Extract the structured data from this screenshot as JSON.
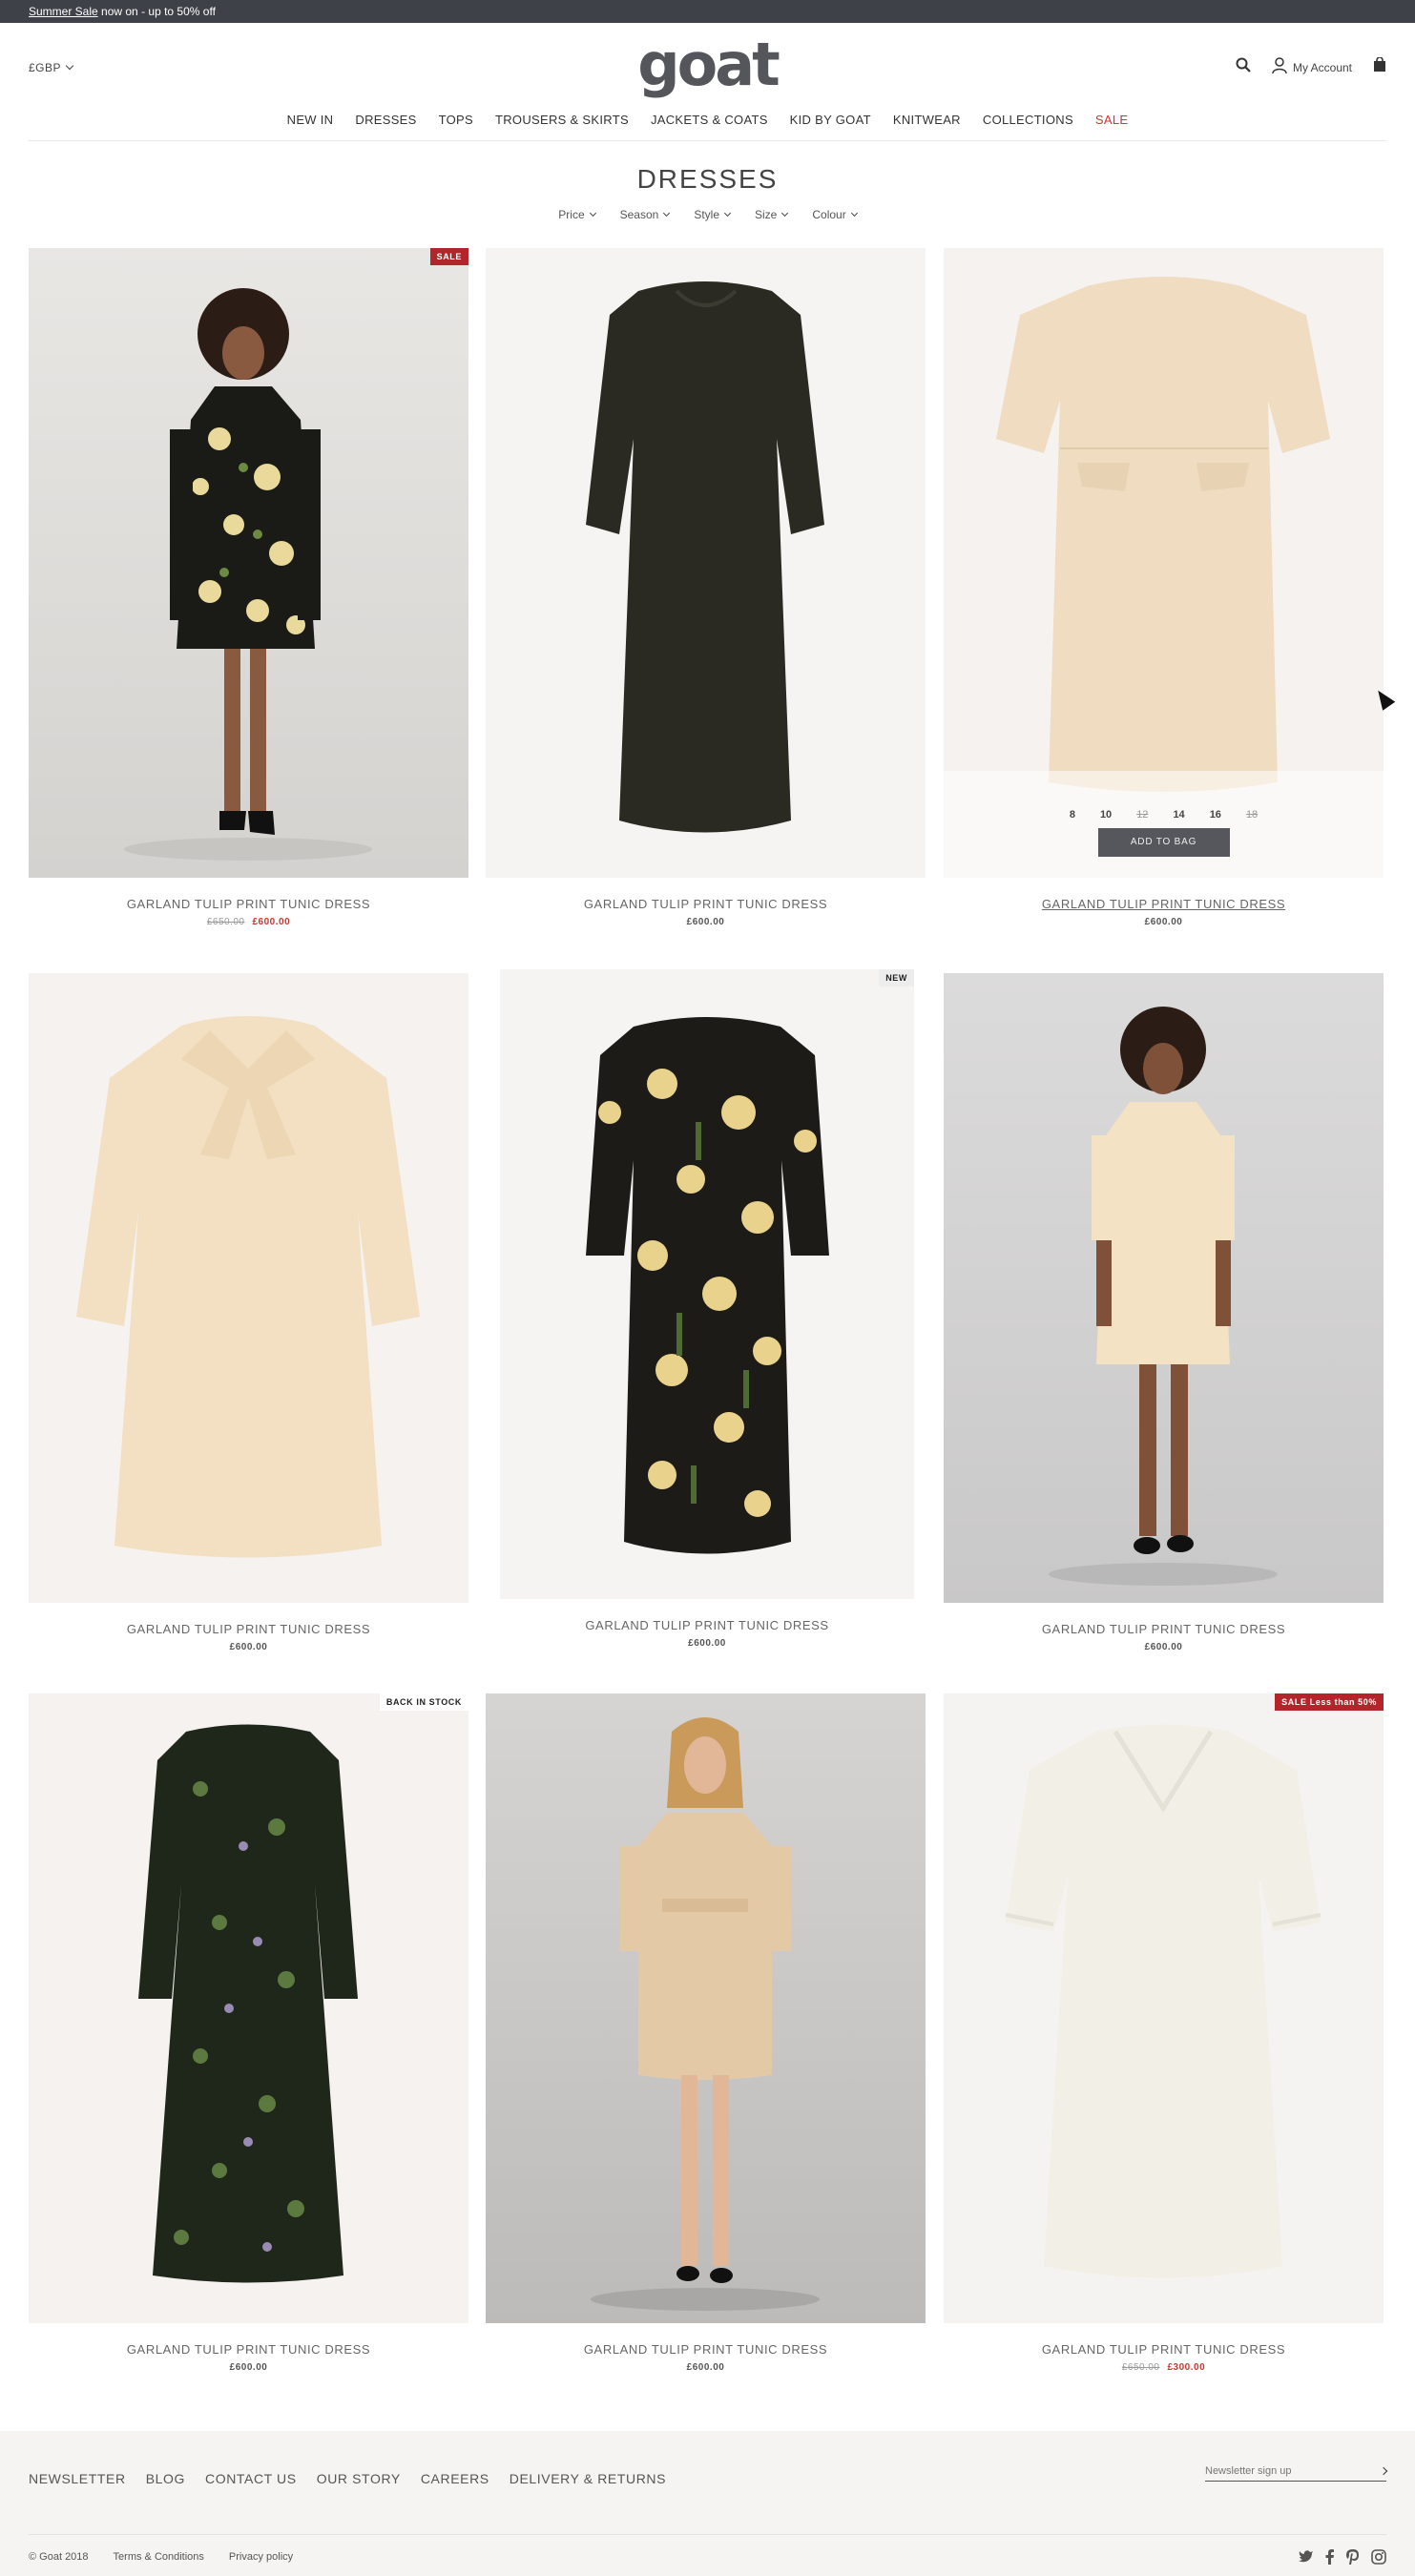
{
  "promo": {
    "link": "Summer Sale",
    "text": " now on - up to 50% off"
  },
  "header": {
    "currency": "£GBP",
    "logo": "goat",
    "account_label": "My Account"
  },
  "nav": [
    {
      "label": "NEW IN",
      "sale": false
    },
    {
      "label": "DRESSES",
      "sale": false
    },
    {
      "label": "TOPS",
      "sale": false
    },
    {
      "label": "TROUSERS & SKIRTS",
      "sale": false
    },
    {
      "label": "JACKETS & COATS",
      "sale": false
    },
    {
      "label": "KID BY GOAT",
      "sale": false
    },
    {
      "label": "KNITWEAR",
      "sale": false
    },
    {
      "label": "COLLECTIONS",
      "sale": false
    },
    {
      "label": "SALE",
      "sale": true
    }
  ],
  "page": {
    "title": "DRESSES",
    "filters": [
      "Price",
      "Season",
      "Style",
      "Size",
      "Colour"
    ]
  },
  "products": [
    {
      "name": "GARLAND TULIP PRINT TUNIC DRESS",
      "old_price": "£650.00",
      "price": "£600.00",
      "badge": "SALE",
      "badge_style": "red"
    },
    {
      "name": "GARLAND TULIP PRINT TUNIC DRESS",
      "old_price": "",
      "price": "£600.00",
      "badge": "",
      "badge_style": ""
    },
    {
      "name": "GARLAND TULIP PRINT TUNIC DRESS",
      "old_price": "",
      "price": "£600.00",
      "badge": "",
      "badge_style": "",
      "sizes": [
        {
          "v": "8",
          "a": true
        },
        {
          "v": "10",
          "a": true
        },
        {
          "v": "12",
          "a": false
        },
        {
          "v": "14",
          "a": true
        },
        {
          "v": "16",
          "a": true
        },
        {
          "v": "18",
          "a": false
        }
      ],
      "add_to_bag": "ADD TO BAG"
    },
    {
      "name": "GARLAND TULIP PRINT TUNIC DRESS",
      "old_price": "",
      "price": "£600.00",
      "badge": "",
      "badge_style": ""
    },
    {
      "name": "GARLAND TULIP PRINT TUNIC DRESS",
      "old_price": "",
      "price": "£600.00",
      "badge": "NEW",
      "badge_style": "light"
    },
    {
      "name": "GARLAND TULIP PRINT TUNIC DRESS",
      "old_price": "",
      "price": "£600.00",
      "badge": "",
      "badge_style": ""
    },
    {
      "name": "GARLAND TULIP PRINT TUNIC DRESS",
      "old_price": "",
      "price": "£600.00",
      "badge": "BACK IN STOCK",
      "badge_style": "white"
    },
    {
      "name": "GARLAND TULIP PRINT TUNIC DRESS",
      "old_price": "",
      "price": "£600.00",
      "badge": "",
      "badge_style": ""
    },
    {
      "name": "GARLAND TULIP PRINT TUNIC DRESS",
      "old_price": "£650.00",
      "price": "£300.00",
      "badge": "SALE Less than 50%",
      "badge_style": "red"
    }
  ],
  "footer": {
    "links": [
      "NEWSLETTER",
      "BLOG",
      "CONTACT US",
      "OUR STORY",
      "CAREERS",
      "DELIVERY & RETURNS"
    ],
    "newsletter_placeholder": "Newsletter sign up",
    "copyright": "© Goat 2018",
    "terms": "Terms & Conditions",
    "privacy": "Privacy policy"
  },
  "colors": {
    "promo_bg": "#3f4148",
    "sale_red": "#c33a2f",
    "badge_red": "#b3252b",
    "add_to_bag_bg": "#55575c"
  }
}
